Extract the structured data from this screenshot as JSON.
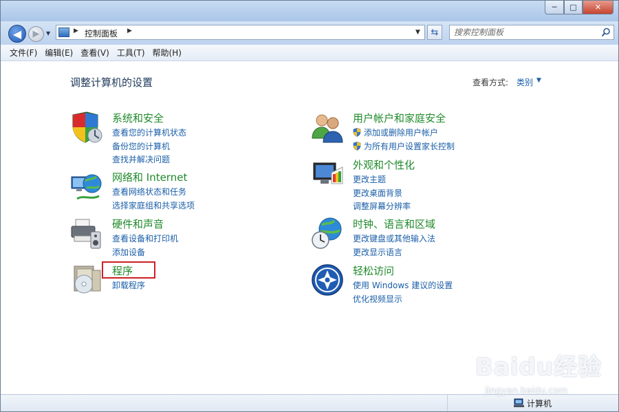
{
  "window": {
    "min_glyph": "─",
    "max_glyph": "□",
    "close_glyph": "✕"
  },
  "nav": {
    "back_glyph": "◀",
    "forward_glyph": "▶"
  },
  "address": {
    "path": "控制面板"
  },
  "search": {
    "placeholder": "搜索控制面板"
  },
  "menubar": {
    "items": [
      "文件(F)",
      "编辑(E)",
      "查看(V)",
      "工具(T)",
      "帮助(H)"
    ]
  },
  "main": {
    "heading": "调整计算机的设置",
    "view_by_label": "查看方式:",
    "view_by_value": "类别"
  },
  "categories": [
    {
      "title": "系统和安全",
      "icon": "security-shield-icon",
      "links": [
        "查看您的计算机状态",
        "备份您的计算机",
        "查找并解决问题"
      ]
    },
    {
      "title": "网络和 Internet",
      "icon": "network-globe-icon",
      "links": [
        "查看网络状态和任务",
        "选择家庭组和共享选项"
      ]
    },
    {
      "title": "硬件和声音",
      "icon": "printer-speaker-icon",
      "links": [
        "查看设备和打印机",
        "添加设备"
      ]
    },
    {
      "title": "程序",
      "icon": "programs-disc-icon",
      "links": [
        "卸载程序"
      ]
    },
    {
      "title": "用户帐户和家庭安全",
      "icon": "users-icon",
      "links": [
        "添加或删除用户帐户",
        "为所有用户设置家长控制"
      ]
    },
    {
      "title": "外观和个性化",
      "icon": "monitor-palette-icon",
      "links": [
        "更改主题",
        "更改桌面背景",
        "调整屏幕分辨率"
      ]
    },
    {
      "title": "时钟、语言和区域",
      "icon": "clock-globe-icon",
      "links": [
        "更改键盘或其他输入法",
        "更改显示语言"
      ]
    },
    {
      "title": "轻松访问",
      "icon": "ease-of-access-icon",
      "links": [
        "使用 Windows 建议的设置",
        "优化视频显示"
      ]
    }
  ],
  "status": {
    "text": "计算机"
  },
  "watermark": {
    "logo": "Baidu经验",
    "url": "jingyan.baidu.com"
  },
  "colors": {
    "link": "#1a5ea8",
    "category_title": "#1f8a2a",
    "highlight": "#cc1f24"
  }
}
